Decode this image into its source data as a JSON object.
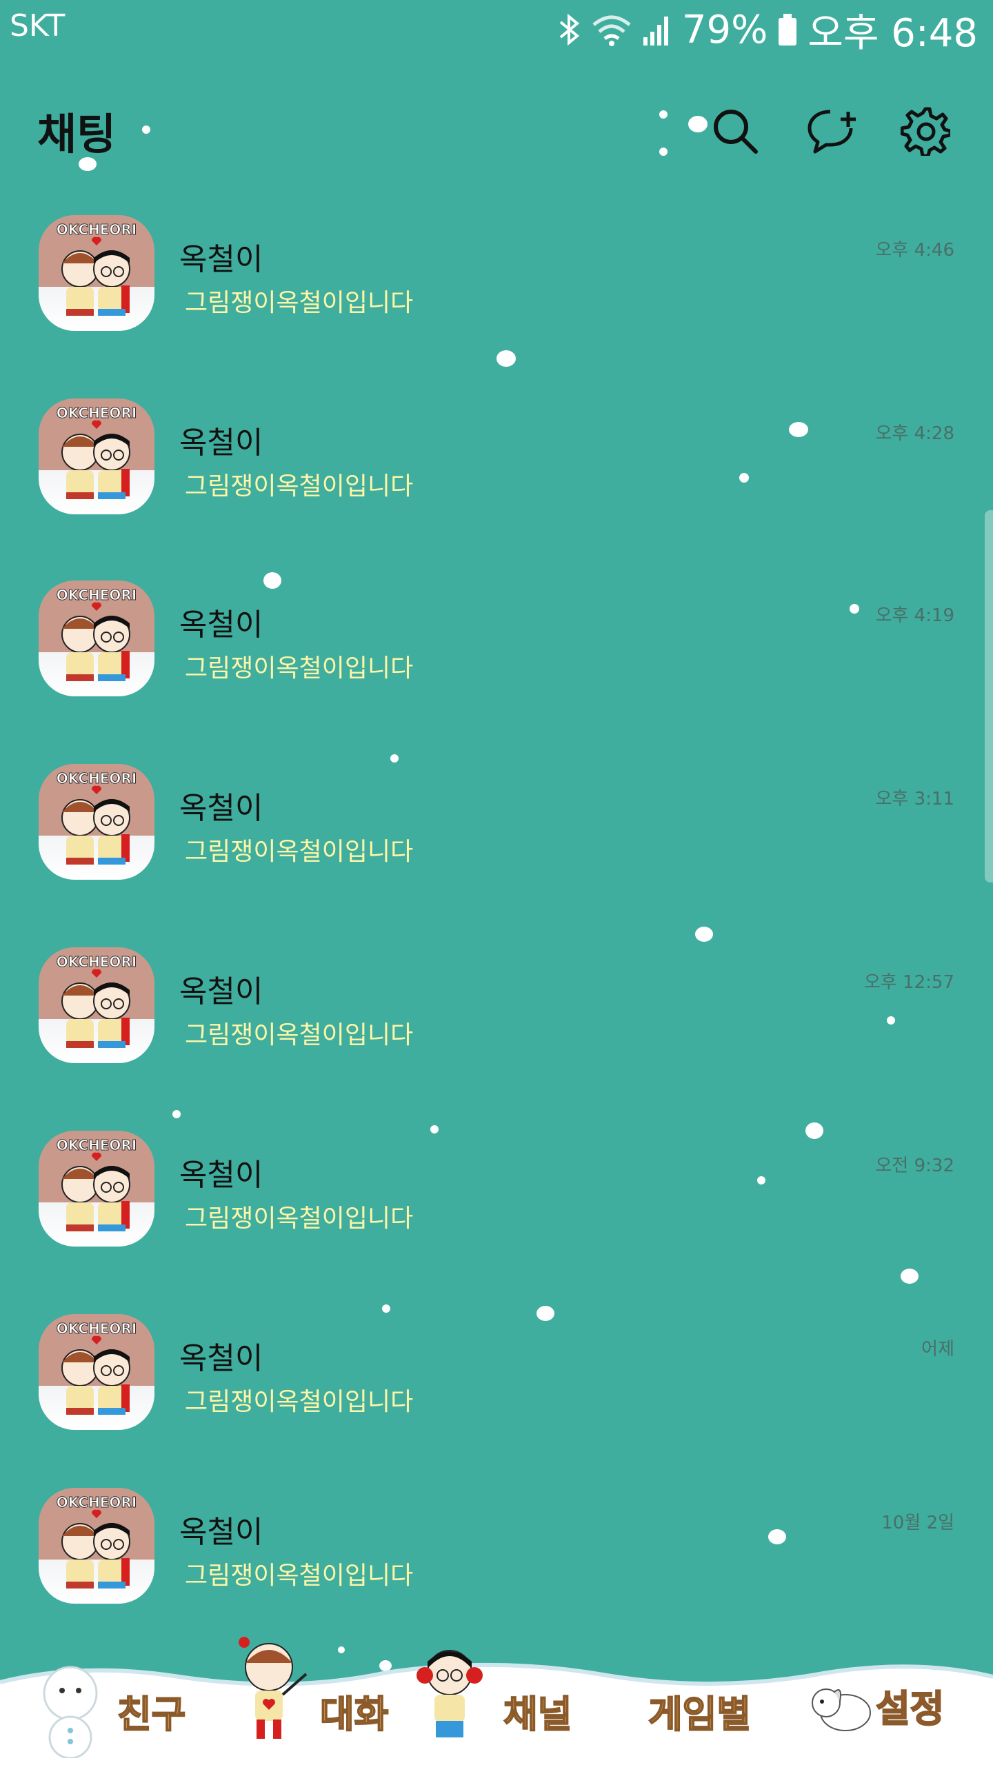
{
  "status_bar": {
    "carrier": "SKT",
    "battery": "79%",
    "time": "오후 6:48"
  },
  "header": {
    "title": "채팅"
  },
  "chats": [
    {
      "name": "옥철이",
      "preview": "그림쟁이옥철이입니다",
      "time": "오후 4:46",
      "avatar_text": "OKCHEORI"
    },
    {
      "name": "옥철이",
      "preview": "그림쟁이옥철이입니다",
      "time": "오후 4:28",
      "avatar_text": "OKCHEORI"
    },
    {
      "name": "옥철이",
      "preview": "그림쟁이옥철이입니다",
      "time": "오후 4:19",
      "avatar_text": "OKCHEORI"
    },
    {
      "name": "옥철이",
      "preview": "그림쟁이옥철이입니다",
      "time": "오후 3:11",
      "avatar_text": "OKCHEORI"
    },
    {
      "name": "옥철이",
      "preview": "그림쟁이옥철이입니다",
      "time": "오후 12:57",
      "avatar_text": "OKCHEORI"
    },
    {
      "name": "옥철이",
      "preview": "그림쟁이옥철이입니다",
      "time": "오전 9:32",
      "avatar_text": "OKCHEORI"
    },
    {
      "name": "옥철이",
      "preview": "그림쟁이옥철이입니다",
      "time": "어제",
      "avatar_text": "OKCHEORI"
    },
    {
      "name": "옥철이",
      "preview": "그림쟁이옥철이입니다",
      "time": "10월 2일",
      "avatar_text": "OKCHEORI"
    }
  ],
  "tabs": [
    {
      "label": "친구"
    },
    {
      "label": "대화"
    },
    {
      "label": "채널"
    },
    {
      "label": "게임별"
    },
    {
      "label": "설정"
    }
  ],
  "colors": {
    "background": "#3fae9e",
    "preview_text": "#fff6a8",
    "tab_label": "#e8a45a"
  }
}
